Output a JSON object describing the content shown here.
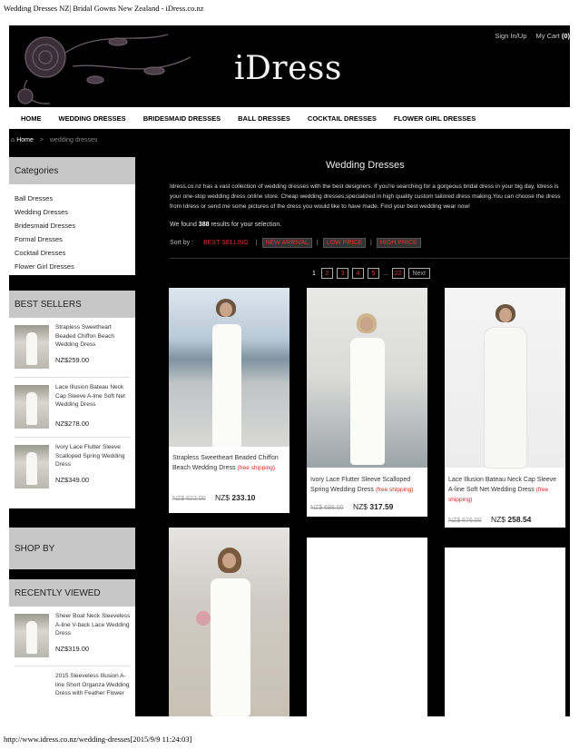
{
  "print": {
    "title": "Wedding Dresses NZ| Bridal Gowns New Zealand - iDress.co.nz",
    "footer": "http://www.idress.co.nz/wedding-dresses[2015/9/9 11:24:03]"
  },
  "header": {
    "logo": "iDress",
    "sign_in": "Sign In/Up",
    "cart_label": "My Cart",
    "cart_count": "(0)"
  },
  "nav": [
    "HOME",
    "WEDDING DRESSES",
    "BRIDESMAID DRESSES",
    "BALL DRESSES",
    "COCKTAIL DRESSES",
    "FLOWER GIRL DRESSES"
  ],
  "breadcrumb": {
    "home": "Home",
    "separator": ">",
    "current": "wedding dresses"
  },
  "categories": {
    "title": "Categories",
    "items": [
      "Ball Dresses",
      "Wedding Dresses",
      "Bridesmaid Dresses",
      "Formal Dresses",
      "Cocktail Dresses",
      "Flower Girl Dresses"
    ]
  },
  "best_sellers": {
    "title": "BEST SELLERS",
    "items": [
      {
        "name": "Strapless Sweetheart Beaded Chiffon Beach Wedding Dress",
        "price": "NZ$259.00"
      },
      {
        "name": "Lace Illusion Bateau Neck Cap Sleeve A-line Soft Net Wedding Dress",
        "price": "NZ$278.00"
      },
      {
        "name": "Ivory Lace Flutter Sleeve Scalloped Spring Wedding Dress",
        "price": "NZ$349.00"
      }
    ]
  },
  "shop_by": {
    "title": "SHOP BY"
  },
  "recently_viewed": {
    "title": "RECENTLY VIEWED",
    "items": [
      {
        "name": "Sheer Boat Neck Sleeveless A-line V-back Lace Wedding Dress",
        "price": "NZ$319.00"
      },
      {
        "name": "2015 Sleeveless Illusion A-line Short Organza Wedding Dress with Feather Flower",
        "price": ""
      }
    ]
  },
  "main": {
    "title": "Wedding Dresses",
    "intro": "Idress.co.nz has a vast collection of wedding dresses with the best designers. If you're searching for a gorgeous bridal dress in your big day, Idress is your one-stop wedding dress online store. Cheap wedding dresses,specialized in high quality custom tailored dress making.You can choose the dress from Idress or send me some pictures of the dress you would like to have made. Find your best wedding wear now!",
    "found_prefix": "We found",
    "found_count": "388",
    "found_suffix": "results for your selection.",
    "sort_label": "Sort by :",
    "sort_options": [
      "BEST SELLING",
      "NEW ARRIVAL",
      "LOW PRICE",
      "HIGH PRICE"
    ],
    "sort_separator": "|"
  },
  "pager": {
    "current": "1",
    "pages": [
      "2",
      "3",
      "4",
      "5"
    ],
    "dots": "...",
    "last": "22",
    "next": "Next"
  },
  "products": [
    {
      "name": "Strapless Sweetheart Beaded Chiffon Beach Wedding Dress",
      "shipping": "(free shipping)",
      "old_price": "NZ$ 622.00",
      "new_price_prefix": "NZ$",
      "new_price": "233.10"
    },
    {
      "name": "Ivory Lace Flutter Sleeve Scalloped Spring Wedding Dress",
      "shipping": "(free shipping)",
      "old_price": "NZ$ 698.00",
      "new_price_prefix": "NZ$",
      "new_price": "317.59"
    },
    {
      "name": "Lace Illusion Bateau Neck Cap Sleeve A-line Soft Net Wedding Dress",
      "shipping": "(free shipping)",
      "old_price": "NZ$ 676.00",
      "new_price_prefix": "NZ$",
      "new_price": "258.54"
    }
  ],
  "colors": {
    "accent_red": "#dd3333",
    "page_bg": "#000000",
    "sidebar_head": "#c7c7c7"
  }
}
